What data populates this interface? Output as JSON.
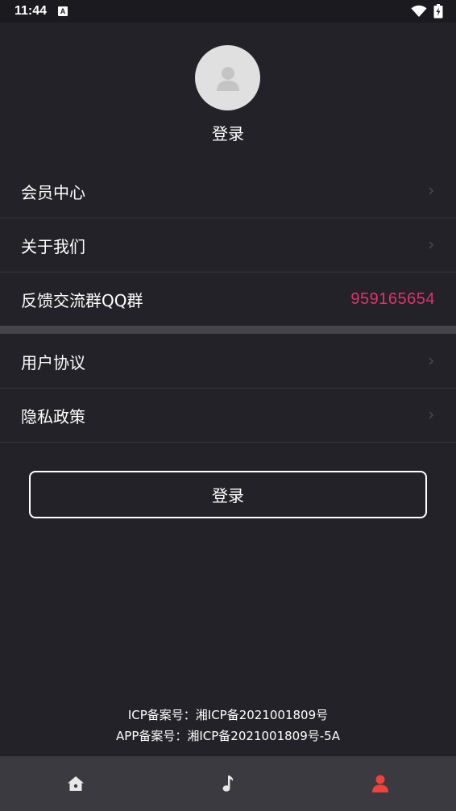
{
  "status_bar": {
    "time": "11:44",
    "notification_badge": "A"
  },
  "profile": {
    "login_text": "登录",
    "avatar_icon": "person-icon"
  },
  "menu_top": [
    {
      "label": "会员中心",
      "has_chevron": true
    },
    {
      "label": "关于我们",
      "has_chevron": true
    },
    {
      "label": "反馈交流群QQ群",
      "value": "959165654"
    }
  ],
  "menu_bottom": [
    {
      "label": "用户协议"
    },
    {
      "label": "隐私政策"
    }
  ],
  "login_button": {
    "label": "登录"
  },
  "footer": {
    "icp": "ICP备案号：湘ICP备2021001809号",
    "app": "APP备案号：湘ICP备2021001809号-5A"
  },
  "tabs": [
    {
      "name": "home",
      "icon": "home-icon",
      "active": false
    },
    {
      "name": "music",
      "icon": "music-note-icon",
      "active": false
    },
    {
      "name": "profile",
      "icon": "person-icon",
      "active": true
    }
  ],
  "colors": {
    "background": "#232228",
    "accent_qq": "#e0336e",
    "tab_active": "#f0413a",
    "tab_inactive": "#e8e8e8"
  }
}
